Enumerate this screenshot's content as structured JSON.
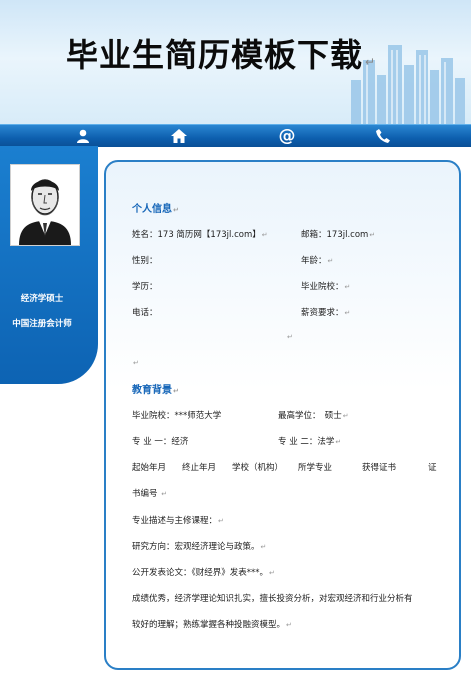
{
  "header": {
    "title": "毕业生简历模板下载",
    "title_mark": "↵"
  },
  "nav": {
    "icons": [
      "person-icon",
      "home-icon",
      "at-icon",
      "phone-icon"
    ]
  },
  "sidebar": {
    "line1": "经济学硕士",
    "line2": "中国注册会计师"
  },
  "mark": "↵",
  "personal": {
    "heading": "个人信息",
    "name": "姓名：173 简历网【173jl.com】",
    "email": "邮箱：173jl.com",
    "gender": "性别：",
    "age": "年龄：",
    "education": "学历：",
    "school": "毕业院校：",
    "phone": "电话：",
    "salary": "薪资要求："
  },
  "edu": {
    "heading": "教育背景",
    "school": "毕业院校：***师范大学",
    "degree": "最高学位：　硕士",
    "major1": "专 业 一：经济",
    "major2": "专 业 二：法学",
    "columns": [
      "起始年月",
      "终止年月",
      "学校（机构）",
      "所学专业",
      "获得证书",
      "证"
    ],
    "columns_cont": "书编号",
    "courses": "专业描述与主修课程：",
    "research": "研究方向：宏观经济理论与政策。",
    "paper": "公开发表论文：《财经界》发表***。",
    "summary1": "成绩优秀，经济学理论知识扎实，擅长投资分析，对宏观经济和行业分析有",
    "summary2": "较好的理解；熟练掌握各种投融资模型。"
  },
  "colors": {
    "accent": "#1666b8",
    "nav": "#0d5fae",
    "card_border": "#2a7fc6"
  }
}
